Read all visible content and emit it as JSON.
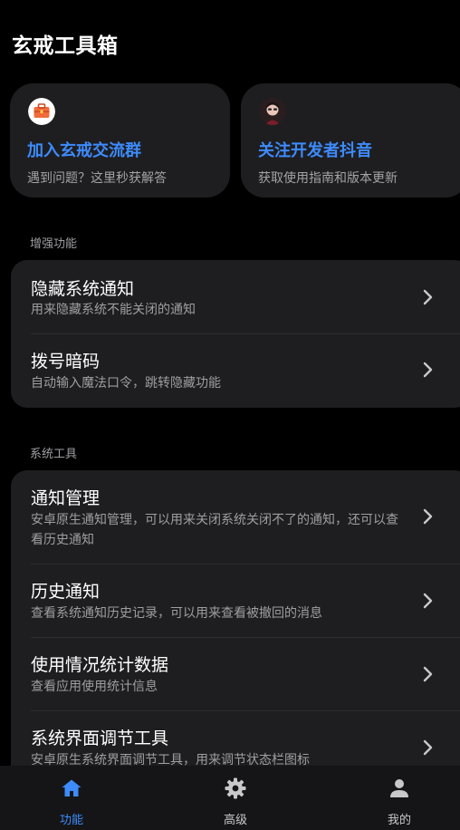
{
  "app": {
    "title": "玄戒工具箱"
  },
  "cards": [
    {
      "title": "加入玄戒交流群",
      "subtitle": "遇到问题？这里秒获解答",
      "icon": "briefcase-icon"
    },
    {
      "title": "关注开发者抖音",
      "subtitle": "获取使用指南和版本更新",
      "icon": "avatar"
    }
  ],
  "sections": [
    {
      "label": "增强功能",
      "items": [
        {
          "title": "隐藏系统通知",
          "desc": "用来隐藏系统不能关闭的通知"
        },
        {
          "title": "拨号暗码",
          "desc": "自动输入魔法口令，跳转隐藏功能"
        }
      ]
    },
    {
      "label": "系统工具",
      "items": [
        {
          "title": "通知管理",
          "desc": "安卓原生通知管理，可以用来关闭系统关闭不了的通知，还可以查看历史通知"
        },
        {
          "title": "历史通知",
          "desc": "查看系统通知历史记录，可以用来查看被撤回的消息"
        },
        {
          "title": "使用情况统计数据",
          "desc": "查看应用使用统计信息"
        },
        {
          "title": "系统界面调节工具",
          "desc": "安卓原生系统界面调节工具，用来调节状态栏图标"
        }
      ]
    }
  ],
  "nav": {
    "items": [
      {
        "label": "功能",
        "icon": "home-icon",
        "active": true
      },
      {
        "label": "高级",
        "icon": "gear-icon",
        "active": false
      },
      {
        "label": "我的",
        "icon": "person-icon",
        "active": false
      }
    ],
    "active_color": "#3d8bfd",
    "inactive_color": "#c8c8cc"
  }
}
